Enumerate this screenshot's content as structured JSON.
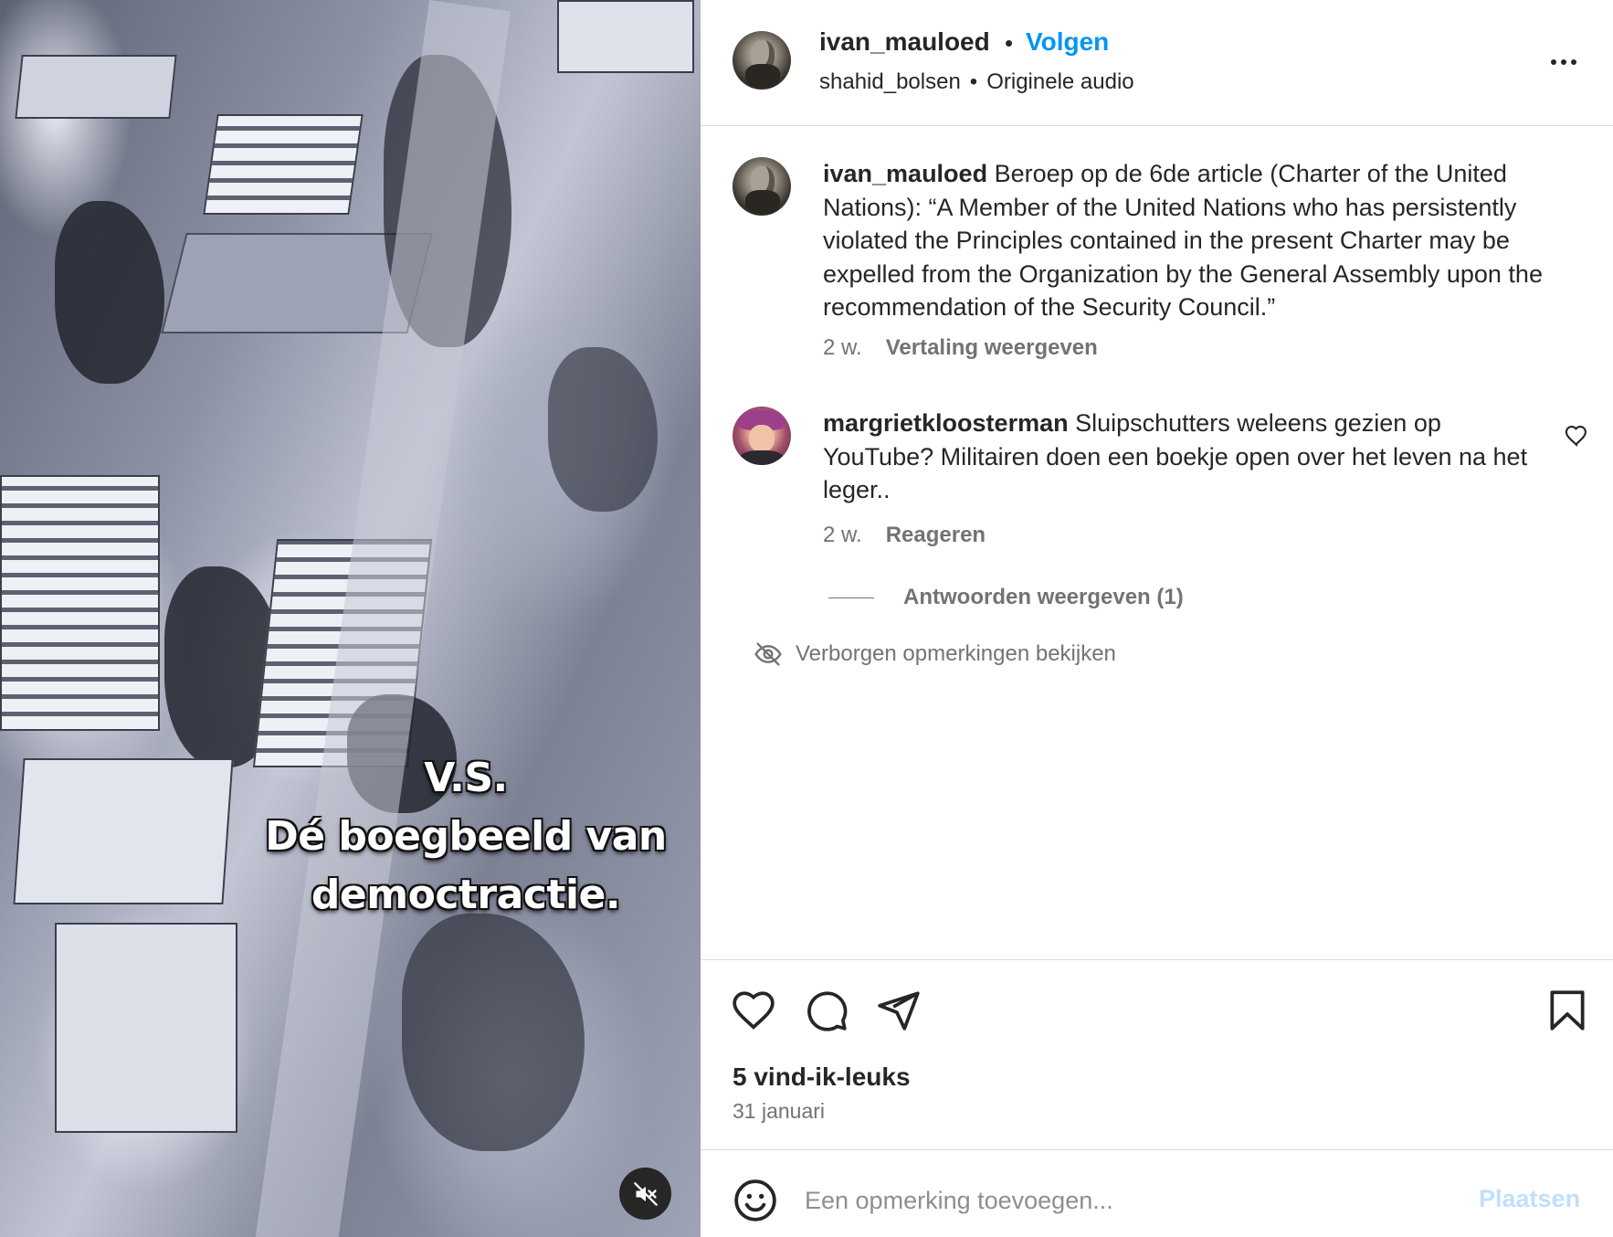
{
  "media": {
    "caption_lines": [
      "V.S.",
      "Dé boegbeeld van",
      "democtractie."
    ],
    "mute_icon": "speaker-muted-icon"
  },
  "header": {
    "username": "ivan_mauloed",
    "separator": "•",
    "follow_label": "Volgen",
    "audio_author": "shahid_bolsen",
    "audio_separator": "•",
    "audio_label": "Originele audio",
    "more_icon": "more-options-icon"
  },
  "comments": [
    {
      "username": "ivan_mauloed",
      "text": "Beroep op de 6de article (Charter of the United Nations): “A Member of the United Nations who has persistently violated the Principles contained in the present Charter may be expelled from the Organization by the General Assembly upon the recommendation of the Security Council.”",
      "age": "2 w.",
      "action": "Vertaling weergeven"
    },
    {
      "username": "margrietkloosterman",
      "text": "Sluipschutters weleens gezien op YouTube? Militairen doen een boekje open over het leven na het leger..",
      "age": "2 w.",
      "action": "Reageren"
    }
  ],
  "replies_toggle": "Antwoorden weergeven (1)",
  "hidden_comments": "Verborgen opmerkingen bekijken",
  "actions": {
    "likes": "5 vind-ik-leuks",
    "date": "31 januari",
    "icons": [
      "heart-icon",
      "comment-icon",
      "share-icon",
      "bookmark-icon"
    ]
  },
  "add_comment": {
    "placeholder": "Een opmerking toevoegen...",
    "post_label": "Plaatsen",
    "emoji_icon": "emoji-icon"
  },
  "colors": {
    "accent": "#0095f6",
    "post_disabled": "#c0dffd",
    "secondary_text": "#737373"
  }
}
